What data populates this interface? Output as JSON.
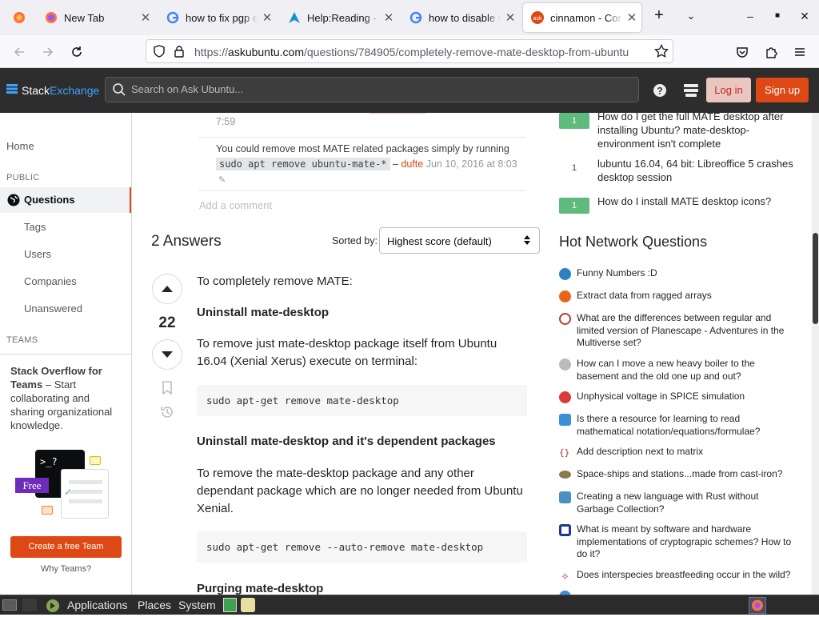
{
  "browser": {
    "tabs": [
      {
        "title": "",
        "icon": "firefox-view-icon"
      },
      {
        "title": "New Tab",
        "icon": "firefox-icon"
      },
      {
        "title": "how to fix pgp e",
        "icon": "google-icon"
      },
      {
        "title": "Help:Reading - A",
        "icon": "arch-icon"
      },
      {
        "title": "how to disable m",
        "icon": "google-icon"
      },
      {
        "title": "cinnamon - Com",
        "icon": "askubuntu-icon",
        "active": true
      }
    ],
    "url_prefix": "https://",
    "url_domain": "askubuntu.com",
    "url_path": "/questions/784905/completely-remove-mate-desktop-from-ubuntu"
  },
  "site_header": {
    "logo_stack": "Stack",
    "logo_exchange": "Exchange",
    "search_placeholder": "Search on Ask Ubuntu...",
    "login_label": "Log in",
    "signup_label": "Sign up"
  },
  "left_nav": {
    "home": "Home",
    "public_heading": "PUBLIC",
    "questions": "Questions",
    "tags": "Tags",
    "users": "Users",
    "companies": "Companies",
    "unanswered": "Unanswered",
    "teams_heading": "TEAMS",
    "teams_title": "Stack Overflow for Teams",
    "teams_text": " – Start collaborating and sharing organizational knowledge.",
    "teams_prompt": ">_?",
    "free_badge": "Free",
    "create_team": "Create a free Team",
    "why_teams": "Why Teams?"
  },
  "comments": [
    {
      "time_tail": "7:59"
    },
    {
      "text": "You could remove most MATE related packages simply by running ",
      "code": "sudo apt remove ubuntu-mate-*",
      "sep": " – ",
      "user": "dufte",
      "date": " Jun 10, 2016 at 8:03"
    }
  ],
  "add_comment": "Add a comment",
  "answers": {
    "count_label": "2 Answers",
    "sorted_by_label": "Sorted by:",
    "sort_value": "Highest score (default)",
    "vote_count": "22",
    "intro": "To completely remove MATE:",
    "h1": "Uninstall mate-desktop",
    "p1": "To remove just mate-desktop package itself from Ubuntu 16.04 (Xenial Xerus) execute on terminal:",
    "code1": "sudo apt-get remove mate-desktop",
    "h2": "Uninstall mate-desktop and it's dependent packages",
    "p2": "To remove the mate-desktop package and any other dependant package which are no longer needed from Ubuntu Xenial.",
    "code2": "sudo apt-get remove --auto-remove mate-desktop",
    "h3": "Purging mate-desktop"
  },
  "related": [
    {
      "score": "1",
      "accepted": true,
      "title": "How do I get the full MATE desktop after installing Ubuntu? mate-desktop-environment isn't complete"
    },
    {
      "score": "1",
      "accepted": false,
      "title": "lubuntu 16.04, 64 bit: Libreoffice 5 crashes desktop session"
    },
    {
      "score": "1",
      "accepted": true,
      "title": "How do I install MATE desktop icons?"
    }
  ],
  "hot_network_heading": "Hot Network Questions",
  "hot_network": [
    {
      "title": "Funny Numbers :D",
      "icon": "puzzling-icon",
      "color": "#2f7fc1"
    },
    {
      "title": "Extract data from ragged arrays",
      "icon": "codegolf-icon",
      "color": "#e8661c"
    },
    {
      "title": "What are the differences between regular and limited version of Planescape - Adventures in the Multiverse set?",
      "icon": "rpg-icon",
      "color": "#c0392b"
    },
    {
      "title": "How can I move a new heavy boiler to the basement and the old one up and out?",
      "icon": "diy-icon",
      "color": "#7a7a7a"
    },
    {
      "title": "Unphysical voltage in SPICE simulation",
      "icon": "electronics-icon",
      "color": "#d93b3b"
    },
    {
      "title": "Is there a resource for learning to read mathematical notation/equations/formulae?",
      "icon": "math-educators-icon",
      "color": "#3d8fd6"
    },
    {
      "title": "Add description next to matrix",
      "icon": "tex-icon",
      "color": "#b03030"
    },
    {
      "title": "Space-ships and stations...made from cast-iron?",
      "icon": "worldbuilding-icon",
      "color": "#8c7b4a"
    },
    {
      "title": "Creating a new language with Rust without Garbage Collection?",
      "icon": "pl-design-icon",
      "color": "#4a90c2"
    },
    {
      "title": "What is meant by software and hardware implementations of cryptograpic schemes? How to do it?",
      "icon": "crypto-icon",
      "color": "#1a3a8a"
    },
    {
      "title": "Does interspecies breastfeeding occur in the wild?",
      "icon": "biology-icon",
      "color": "#b0456a"
    }
  ],
  "taskbar": {
    "applications": "Applications",
    "places": "Places",
    "system": "System"
  }
}
